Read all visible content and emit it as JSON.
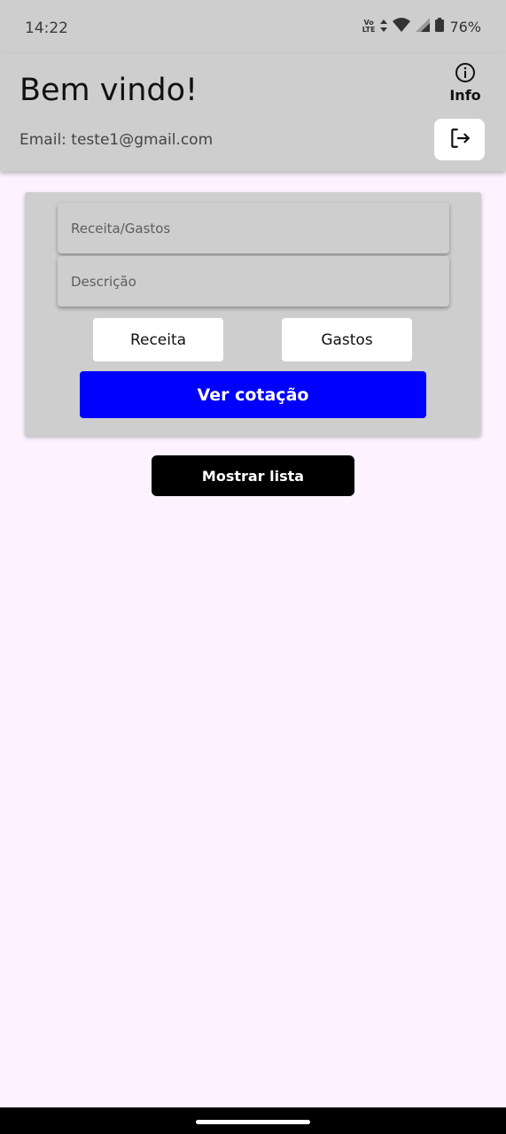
{
  "status_bar": {
    "time": "14:22",
    "network_label": "Vo LTE",
    "battery_percent": "76%",
    "icons": [
      "volte-icon",
      "data-arrows-icon",
      "wifi-icon",
      "signal-icon",
      "battery-icon"
    ]
  },
  "header": {
    "title": "Bem vindo!",
    "info_label": "Info",
    "email": "Email: teste1@gmail.com",
    "logout_icon": "logout-icon"
  },
  "form": {
    "amount_placeholder": "Receita/Gastos",
    "description_placeholder": "Descrição",
    "income_button": "Receita",
    "expense_button": "Gastos",
    "quote_button": "Ver cotação"
  },
  "list_button": "Mostrar lista",
  "colors": {
    "background": "#fdf2ff",
    "header": "#cecece",
    "primary_blue": "#0000ff",
    "black": "#000000"
  }
}
